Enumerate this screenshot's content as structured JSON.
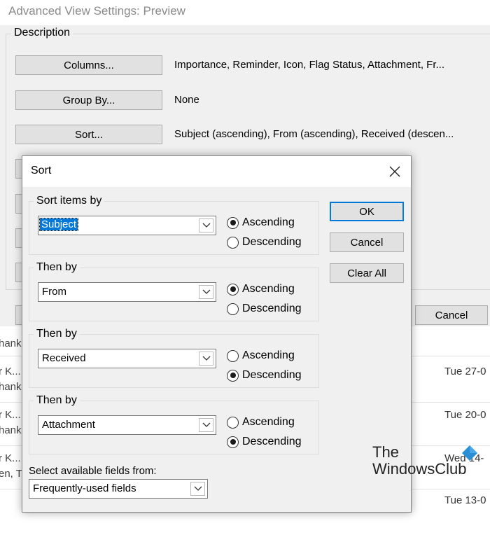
{
  "window": {
    "title": "Advanced View Settings: Preview",
    "group_label": "Description",
    "buttons": [
      {
        "label": "Columns...",
        "value": "Importance, Reminder, Icon, Flag Status, Attachment, Fr..."
      },
      {
        "label": "Group By...",
        "value": "None"
      },
      {
        "label": "Sort...",
        "value": "Subject (ascending), From (ascending), Received (descen..."
      }
    ],
    "cancel_label": "Cancel"
  },
  "mail_list": {
    "rows": [
      {
        "line1": "hank",
        "line2": "",
        "date": ""
      },
      {
        "line1": "r K...",
        "line2": "hank",
        "date": "Tue 27-0"
      },
      {
        "line1": "r K...",
        "line2": "hank",
        "date": "Tue 20-0"
      },
      {
        "line1": "r K...",
        "line2": "en, T",
        "date": "Wed 14-"
      },
      {
        "line1": "",
        "line2": "",
        "date": "Tue 13-0"
      }
    ]
  },
  "sort_dialog": {
    "title": "Sort",
    "groups": [
      {
        "label": "Sort items by",
        "field": "Subject",
        "ascending": true,
        "focused": true
      },
      {
        "label": "Then by",
        "field": "From",
        "ascending": true,
        "focused": false
      },
      {
        "label": "Then by",
        "field": "Received",
        "ascending": false,
        "focused": false
      },
      {
        "label": "Then by",
        "field": "Attachment",
        "ascending": false,
        "focused": false
      }
    ],
    "ascending_label": "Ascending",
    "descending_label": "Descending",
    "ok_label": "OK",
    "cancel_label": "Cancel",
    "clear_all_label": "Clear All",
    "fields_label": "Select available fields from:",
    "fields_value": "Frequently-used fields"
  },
  "watermark": {
    "line1": "The",
    "line2": "WindowsClub"
  },
  "colors": {
    "accent": "#0078d7",
    "dialog_bg": "#f0f0f0",
    "button_bg": "#e1e1e1"
  }
}
